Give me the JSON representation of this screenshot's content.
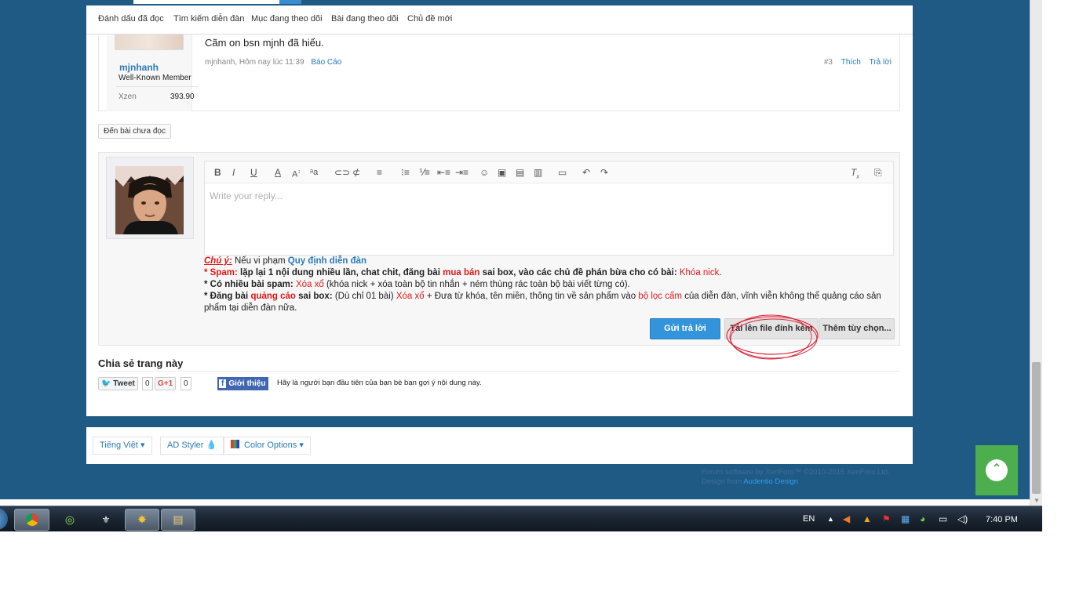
{
  "nav": {
    "items": [
      "Đánh dấu đã đọc",
      "Tìm kiếm diễn đàn",
      "Mục đang theo dõi",
      "Bài đang theo dõi",
      "Chủ đề mới"
    ]
  },
  "post": {
    "username": "mjnhanh",
    "user_title": "Well-Known Member",
    "stat_label": "Xzen",
    "stat_value": "393.90",
    "message": "Cãm on bsn mjnh đã hiểu.",
    "meta": "mjnhanh, Hôm nay lúc 11:39",
    "report_label": "Báo Cáo",
    "post_number": "#3",
    "like_label": "Thích",
    "reply_label": "Trả lời"
  },
  "jump_label": "Đến bài chưa đọc",
  "editor": {
    "placeholder": "Write your reply..."
  },
  "notice": {
    "title": "Chú ý:",
    "intro": "Nếu vi phạm",
    "rules_link": "Quy định diễn đàn",
    "line1_a": "* Spam:",
    "line1_b": "lặp lại 1 nội dung nhiều lần, chat chit, đăng bài",
    "line1_c": "mua bán",
    "line1_d": "sai box, vào các chủ đề phán bừa cho có bài:",
    "line1_e": "Khóa nick",
    "line2_a": "* Có nhiều bài spam:",
    "line2_b": "Xóa xổ",
    "line2_c": "(khóa nick + xóa toàn bộ tin nhắn + ném thùng rác toàn bộ bài viết từng có).",
    "line3_a": "* Đăng bài",
    "line3_b": "quảng cáo",
    "line3_c": "sai box:",
    "line3_d": "(Dù chỉ 01 bài)",
    "line3_e": "Xóa xổ",
    "line3_f": "+ Đưa từ khóa, tên miền, thông tin về sản phẩm vào",
    "line3_g": "bộ lọc cấm",
    "line3_h": "của diễn đàn, vĩnh viễn không thể quảng cáo sản phẩm tại diễn đàn nữa."
  },
  "buttons": {
    "submit": "Gửi trả lời",
    "upload": "Tải lên file đính kèm",
    "more": "Thêm tùy chọn..."
  },
  "share": {
    "title": "Chia sẻ trang này",
    "tweet": "Tweet",
    "tweet_count": "0",
    "gplus": "G+1",
    "gplus_count": "0",
    "fb_label": "Giới thiệu",
    "fb_text": "Hãy là người bạn đầu tiên của bạn bè bạn gợi ý nội dung này."
  },
  "footer": {
    "language": "Tiếng Việt",
    "styler": "AD Styler",
    "color_options": "Color Options",
    "copyright": "Forum software by XenForo™ ©2010-2015 XenForo Ltd.",
    "design_prefix": "Design from",
    "design_link": "Audentio Design"
  },
  "taskbar": {
    "language": "EN",
    "clock": "7:40 PM"
  },
  "colors": {
    "page_bg": "#1f5a85",
    "link": "#2b7ab8",
    "submit": "#3394dc",
    "back_to_top": "#4cae4c",
    "warning_red": "#e01818"
  }
}
